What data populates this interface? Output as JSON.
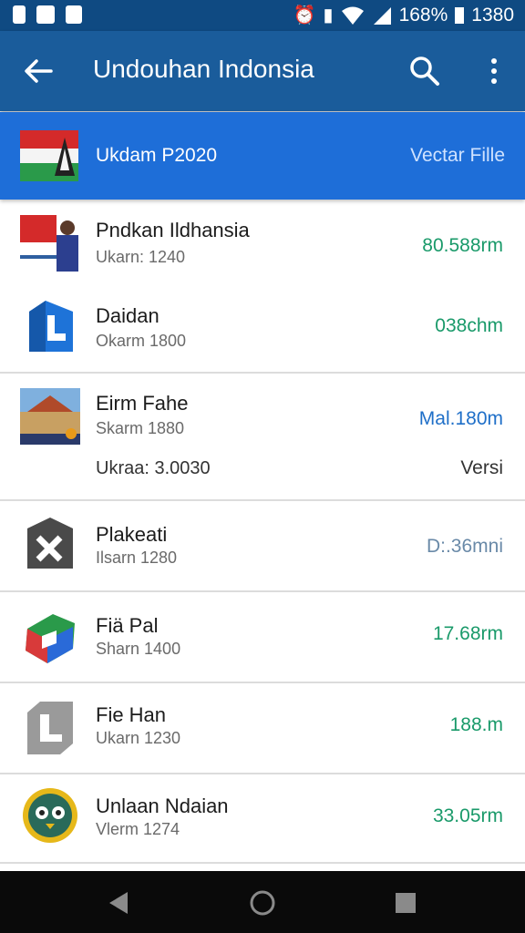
{
  "status": {
    "battery": "168%",
    "time": "1380"
  },
  "app_bar": {
    "title": "Undouhan Indonsia"
  },
  "banner": {
    "name": "Ukdam P2020",
    "action": "Vectar Fille"
  },
  "rows": [
    {
      "name": "Pndkan Ildhansia",
      "sub": "Ukarn: 1240",
      "size": "80.588rm",
      "icon": "indonesia-flag-person-icon"
    },
    {
      "name": "Daidan",
      "sub": "Okarm 1800",
      "size": "038chm",
      "icon": "blue-l-app-icon"
    },
    {
      "name": "Eirm Fahe",
      "sub": "Skarm 1880",
      "size": "Mal.180m",
      "extra_label": "Ukraa: 3.0030",
      "extra_right": "Versi",
      "icon": "building-photo-icon"
    },
    {
      "name": "Plakeati",
      "sub": "Ilsarn 1280",
      "size": "D:.36mni",
      "icon": "dark-x-app-icon"
    },
    {
      "name": "Fiä Pal",
      "sub": "Sharn 1400",
      "size": "17.68rm",
      "icon": "colorful-cube-app-icon"
    },
    {
      "name": "Fie Han",
      "sub": "Ukarn 1230",
      "size": "188.m",
      "icon": "gray-l-app-icon"
    },
    {
      "name": "Unlaan Ndaian",
      "sub": "Vlerm 1274",
      "size": "33.05rm",
      "icon": "owl-app-icon"
    }
  ],
  "colors": {
    "app_bar": "#1a5c9b",
    "banner": "#1e6ed8",
    "size_text": "#1a9a6a"
  }
}
